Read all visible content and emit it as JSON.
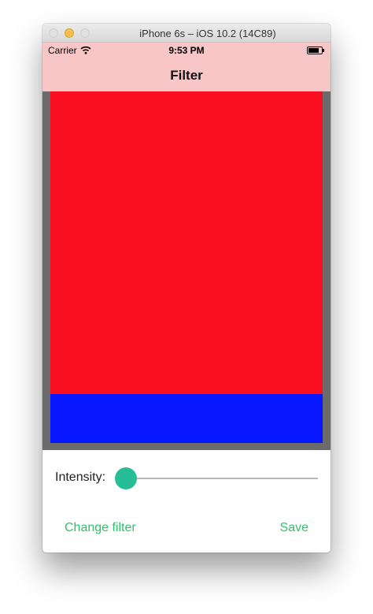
{
  "window": {
    "title": "iPhone 6s – iOS 10.2 (14C89)"
  },
  "status_bar": {
    "carrier": "Carrier",
    "time": "9:53 PM"
  },
  "nav": {
    "title": "Filter"
  },
  "image": {
    "top_color": "#f90f20",
    "bottom_color": "#0717ff",
    "border_color": "#6b6b6b"
  },
  "controls": {
    "intensity_label": "Intensity:",
    "intensity_value": 0,
    "change_filter_label": "Change filter",
    "save_label": "Save",
    "accent_color": "#2ec16b",
    "thumb_color": "#26bd97"
  }
}
